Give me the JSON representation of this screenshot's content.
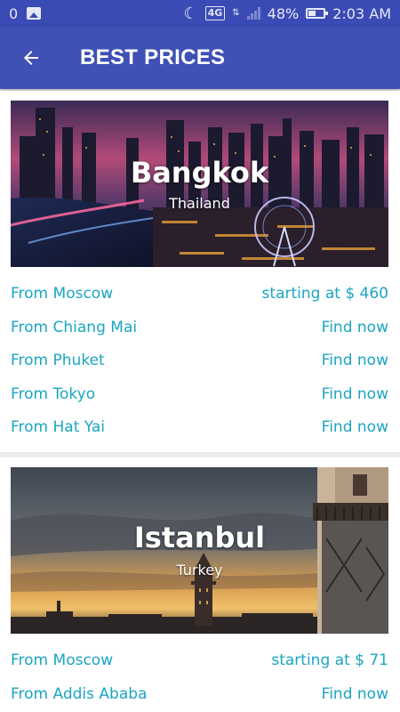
{
  "status_bar": {
    "notification_count": "0",
    "network": "4G",
    "battery": "48%",
    "time": "2:03 AM"
  },
  "app_bar": {
    "title": "BEST PRICES",
    "back_icon": "arrow-left-icon"
  },
  "colors": {
    "primary": "#3f51b5",
    "status_bar": "#3b4bb5",
    "link": "#1ba5c3"
  },
  "destinations": [
    {
      "city": "Bangkok",
      "country": "Thailand",
      "routes": [
        {
          "origin": "From Moscow",
          "price": "starting at $ 460"
        },
        {
          "origin": "From Chiang Mai",
          "price": "Find now"
        },
        {
          "origin": "From Phuket",
          "price": "Find now"
        },
        {
          "origin": "From Tokyo",
          "price": "Find now"
        },
        {
          "origin": "From Hat Yai",
          "price": "Find now"
        }
      ]
    },
    {
      "city": "Istanbul",
      "country": "Turkey",
      "routes": [
        {
          "origin": "From Moscow",
          "price": "starting at $ 71"
        },
        {
          "origin": "From Addis Ababa",
          "price": "Find now"
        }
      ]
    }
  ]
}
